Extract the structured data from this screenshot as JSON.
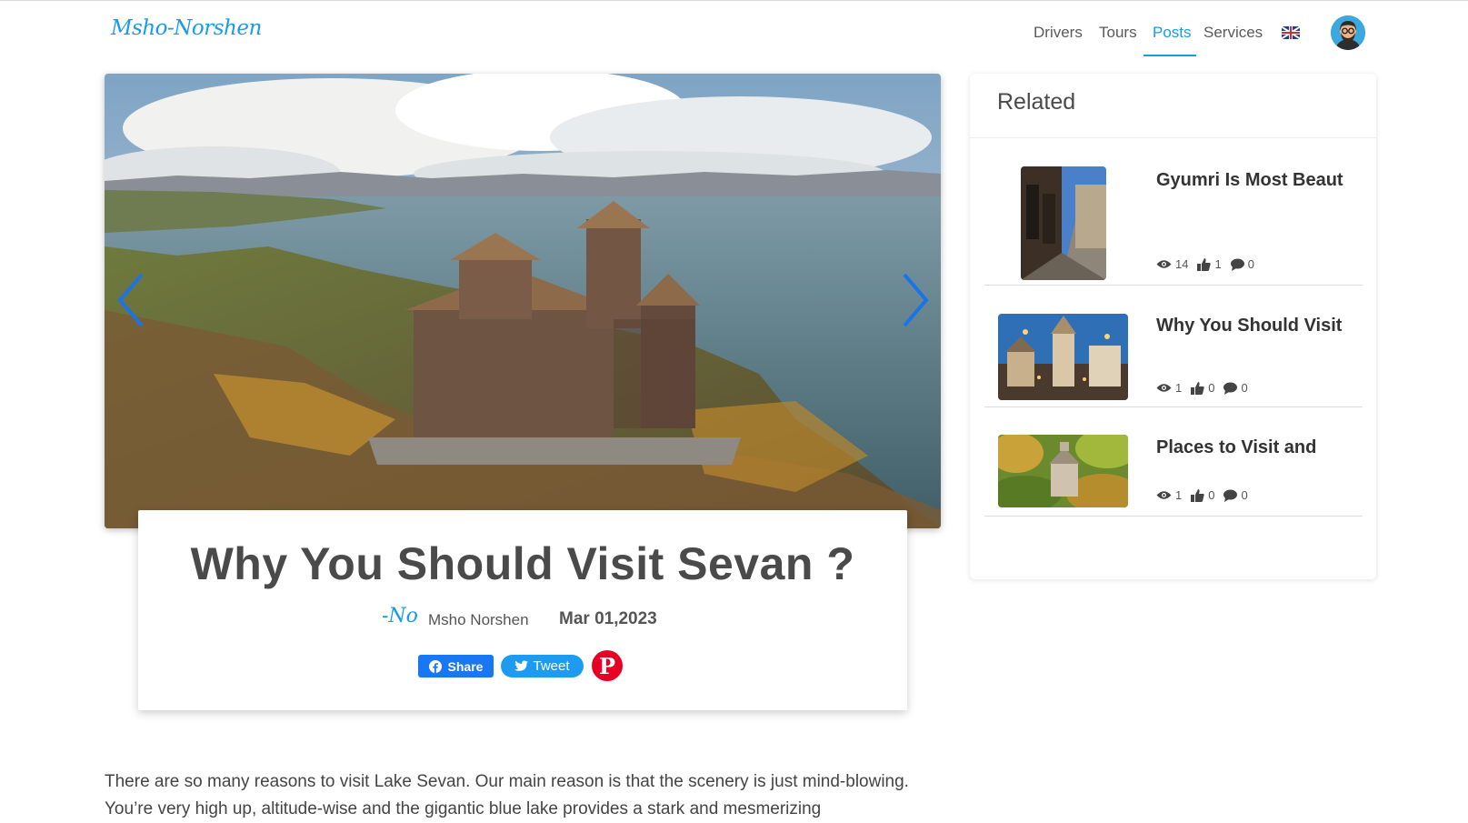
{
  "header": {
    "logo": "Msho-Norshen",
    "nav": [
      {
        "label": "Drivers"
      },
      {
        "label": "Tours"
      },
      {
        "label": "Posts"
      },
      {
        "label": "Services"
      }
    ],
    "active_nav": "Posts",
    "language_flag": "uk-flag-icon",
    "avatar": "user-avatar"
  },
  "post": {
    "title": "Why You Should Visit Sevan ?",
    "author_logo": "-Norshen",
    "author": "Msho Norshen",
    "date": "Mar 01,2023",
    "share_label": "Share",
    "tweet_label": "Tweet",
    "body": "There are so many reasons to visit Lake Sevan. Our main reason is that the scenery is just mind-blowing. You’re very high up, altitude-wise and the gigantic blue lake provides a stark and mesmerizing"
  },
  "related": {
    "heading": "Related",
    "items": [
      {
        "title": "Gyumri Is Most Beaut",
        "views": "14",
        "likes": "1",
        "comments": "0"
      },
      {
        "title": "Why You Should Visit",
        "views": "1",
        "likes": "0",
        "comments": "0"
      },
      {
        "title": "Places to Visit and",
        "views": "1",
        "likes": "0",
        "comments": "0"
      }
    ]
  },
  "colors": {
    "accent": "#1a9be8",
    "facebook": "#1877f2",
    "twitter": "#1d9bf0",
    "pinterest": "#e60023"
  }
}
